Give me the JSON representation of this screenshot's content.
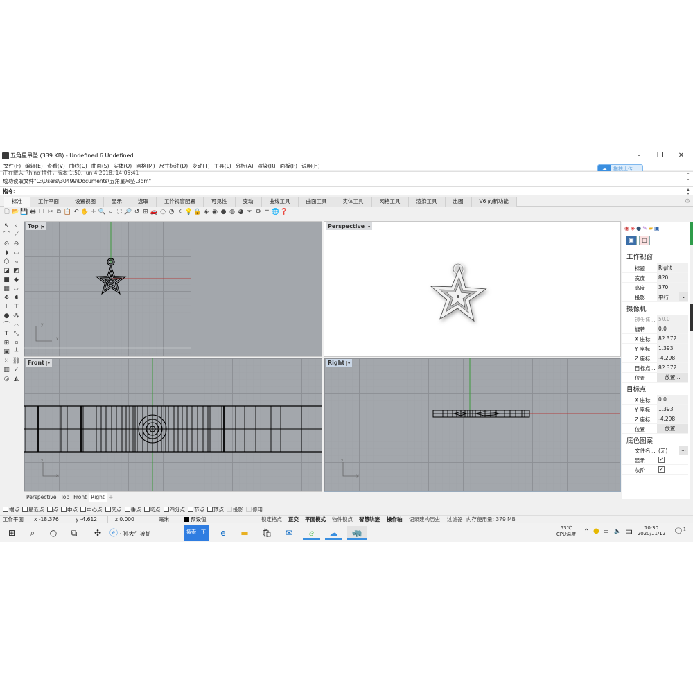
{
  "window": {
    "title": "五角星吊坠 (339 KB) - Undefined 6 Undefined",
    "minimize_icon": "minimize-icon",
    "restore_icon": "restore-icon",
    "close_icon": "close-icon"
  },
  "menu": [
    "文件(F)",
    "编辑(E)",
    "查看(V)",
    "曲线(C)",
    "曲面(S)",
    "实体(O)",
    "网格(M)",
    "尺寸标注(D)",
    "变动(T)",
    "工具(L)",
    "分析(A)",
    "渲染(R)",
    "面板(P)",
    "说明(H)"
  ],
  "upload_badge": {
    "label": "拖拽上传",
    "icon": "cloud-upload-icon"
  },
  "command": {
    "history_clipped": "正在载入 Rhino 插件，版本 1.50, Jun 4 2018, 14:05:41",
    "history_last": "成功读取文件\"C:\\Users\\30499\\Documents\\五角星吊坠.3dm\"",
    "prompt_label": "指令:",
    "input_value": ""
  },
  "toolbar_tabs": [
    "标准",
    "工作平面",
    "设置视图",
    "显示",
    "选取",
    "工作视窗配置",
    "可见性",
    "变动",
    "曲线工具",
    "曲面工具",
    "实体工具",
    "网格工具",
    "渲染工具",
    "出图",
    "V6 的新功能"
  ],
  "active_toolbar_tab": "标准",
  "toolbar_icons": [
    {
      "name": "new-icon",
      "glyph": "🗋"
    },
    {
      "name": "open-icon",
      "glyph": "📂"
    },
    {
      "name": "save-icon",
      "glyph": "💾"
    },
    {
      "name": "print-icon",
      "glyph": "🖶"
    },
    {
      "name": "import-icon",
      "glyph": "❐"
    },
    {
      "name": "cut-icon",
      "glyph": "✂"
    },
    {
      "name": "copy-icon",
      "glyph": "⧉"
    },
    {
      "name": "paste-icon",
      "glyph": "📋"
    },
    {
      "name": "undo-icon",
      "glyph": "↶"
    },
    {
      "name": "pan-icon",
      "glyph": "✋"
    },
    {
      "name": "rotate-view-icon",
      "glyph": "✛"
    },
    {
      "name": "zoom-icon",
      "glyph": "🔍"
    },
    {
      "name": "zoom-window-icon",
      "glyph": "⌕"
    },
    {
      "name": "zoom-extents-icon",
      "glyph": "⛶"
    },
    {
      "name": "zoom-selected-icon",
      "glyph": "🔎"
    },
    {
      "name": "undo-view-icon",
      "glyph": "↺"
    },
    {
      "name": "four-viewports-icon",
      "glyph": "⊞"
    },
    {
      "name": "car-icon",
      "glyph": "🚗"
    },
    {
      "name": "points-on-icon",
      "glyph": "◌"
    },
    {
      "name": "circle-icon",
      "glyph": "◔"
    },
    {
      "name": "select-icon",
      "glyph": "☇"
    },
    {
      "name": "light-icon",
      "glyph": "💡"
    },
    {
      "name": "lock-icon",
      "glyph": "🔒"
    },
    {
      "name": "layer-icon",
      "glyph": "◈"
    },
    {
      "name": "color-wheel-icon",
      "glyph": "◉"
    },
    {
      "name": "render-sphere-icon",
      "glyph": "●"
    },
    {
      "name": "material-sphere-icon",
      "glyph": "◍"
    },
    {
      "name": "environment-sphere-icon",
      "glyph": "◕"
    },
    {
      "name": "filter-icon",
      "glyph": "⏷"
    },
    {
      "name": "options-gear-icon",
      "glyph": "⚙"
    },
    {
      "name": "dimension-icon",
      "glyph": "⊏"
    },
    {
      "name": "globe-icon",
      "glyph": "🌐"
    },
    {
      "name": "help-icon",
      "glyph": "❓"
    }
  ],
  "left_toolbar": [
    {
      "name": "select-arrow-icon",
      "glyph": "↖"
    },
    {
      "name": "point-icon",
      "glyph": "∘"
    },
    {
      "name": "polyline-icon",
      "glyph": "⌒"
    },
    {
      "name": "control-point-curve-icon",
      "glyph": "⟋"
    },
    {
      "name": "circle-center-icon",
      "glyph": "⊙"
    },
    {
      "name": "ellipse-icon",
      "glyph": "⊖"
    },
    {
      "name": "arc-icon",
      "glyph": "◗"
    },
    {
      "name": "rectangle-icon",
      "glyph": "▭"
    },
    {
      "name": "polygon-icon",
      "glyph": "⬡"
    },
    {
      "name": "fillet-icon",
      "glyph": "⤷"
    },
    {
      "name": "surface-icon",
      "glyph": "◪"
    },
    {
      "name": "extrude-icon",
      "glyph": "◩"
    },
    {
      "name": "box-icon",
      "glyph": "■"
    },
    {
      "name": "boolean-icon",
      "glyph": "◆"
    },
    {
      "name": "mesh-icon",
      "glyph": "▦"
    },
    {
      "name": "plane-icon",
      "glyph": "▱"
    },
    {
      "name": "transform-icon",
      "glyph": "✥"
    },
    {
      "name": "explode-icon",
      "glyph": "✸"
    },
    {
      "name": "trim-icon",
      "glyph": "⊥"
    },
    {
      "name": "split-icon",
      "glyph": "⊤"
    },
    {
      "name": "group-icon",
      "glyph": "●"
    },
    {
      "name": "ungroup-icon",
      "glyph": "⁂"
    },
    {
      "name": "curve-offset-icon",
      "glyph": "⌒"
    },
    {
      "name": "blend-icon",
      "glyph": "⌓"
    },
    {
      "name": "text-icon",
      "glyph": "T"
    },
    {
      "name": "scale-icon",
      "glyph": "⤡"
    },
    {
      "name": "array-icon",
      "glyph": "⊞"
    },
    {
      "name": "mirror-icon",
      "glyph": "⧈"
    },
    {
      "name": "solid-tools-icon",
      "glyph": "▣"
    },
    {
      "name": "dimension-tools-icon",
      "glyph": "┴"
    },
    {
      "name": "grid-array-icon",
      "glyph": "⁙"
    },
    {
      "name": "chain-icon",
      "glyph": "⛓"
    },
    {
      "name": "analyze-icon",
      "glyph": "▥"
    },
    {
      "name": "check-icon",
      "glyph": "✓"
    },
    {
      "name": "render-icon",
      "glyph": "◎"
    },
    {
      "name": "paint-icon",
      "glyph": "◭"
    }
  ],
  "viewports": {
    "top": {
      "label": "Top",
      "axis_x": "x",
      "axis_y": "y"
    },
    "perspective": {
      "label": "Perspective"
    },
    "front": {
      "label": "Front",
      "axis_x": "x",
      "axis_y": "z"
    },
    "right": {
      "label": "Right",
      "axis_x": "y",
      "axis_y": "z"
    }
  },
  "viewport_tabs": [
    "Perspective",
    "Top",
    "Front",
    "Right"
  ],
  "active_viewport_tab": "Right",
  "add_viewport_tab_icon": "plus-icon",
  "osnaps": [
    {
      "label": "端点",
      "checked": false,
      "disabled": false
    },
    {
      "label": "最近点",
      "checked": false,
      "disabled": false
    },
    {
      "label": "点",
      "checked": false,
      "disabled": false
    },
    {
      "label": "中点",
      "checked": false,
      "disabled": false
    },
    {
      "label": "中心点",
      "checked": false,
      "disabled": false
    },
    {
      "label": "交点",
      "checked": false,
      "disabled": false
    },
    {
      "label": "垂点",
      "checked": false,
      "disabled": false
    },
    {
      "label": "切点",
      "checked": false,
      "disabled": false
    },
    {
      "label": "四分点",
      "checked": false,
      "disabled": false
    },
    {
      "label": "节点",
      "checked": false,
      "disabled": false
    },
    {
      "label": "顶点",
      "checked": false,
      "disabled": false
    },
    {
      "label": "投影",
      "checked": false,
      "disabled": true
    },
    {
      "label": "停用",
      "checked": false,
      "disabled": true
    }
  ],
  "status": {
    "cplane": "工作平面",
    "x": "x -18.376",
    "y": "y -4.612",
    "z": "z 0.000",
    "units": "毫米",
    "layer": "预设值",
    "layer_color": "#000000",
    "grid_snap": "锁定格点",
    "ortho": "正交",
    "planar": "平面模式",
    "osnap": "物件锁点",
    "smarttrack": "智慧轨迹",
    "gumball": "操作轴",
    "history": "记录建构历史",
    "filter": "过滤器",
    "memory": "内存使用量: 379 MB"
  },
  "taskbar": {
    "start_icon": "windows-start-icon",
    "search_icon": "search-icon",
    "cortana_icon": "cortana-circle-icon",
    "taskview_icon": "task-view-icon",
    "app_icon": "fan-app-icon",
    "ie_item_label": "孙大午被抓",
    "search_button": "搜索一下",
    "pinned": [
      "edge-icon",
      "file-explorer-icon",
      "store-icon",
      "mail-icon",
      "ie-browser-icon",
      "baidu-netdisk-icon",
      "rhino-icon"
    ],
    "cpu_temp": "53℃",
    "cpu_label": "CPU温度",
    "tray_chevron": "chevron-up-icon",
    "tray_icons": [
      "security-app-icon",
      "battery-icon",
      "volume-icon"
    ],
    "ime": "中",
    "time": "10:30",
    "date": "2020/11/12",
    "notification_count": "1"
  },
  "panel": {
    "tab_icons": [
      "color-wheel-icon",
      "layer-icon",
      "material-icon",
      "light-icon",
      "folder-icon",
      "help-book-icon"
    ],
    "viewport_section": "工作视窗",
    "viewport_rows": [
      {
        "key": "标题",
        "value": "Right"
      },
      {
        "key": "宽度",
        "value": "820"
      },
      {
        "key": "高度",
        "value": "370"
      },
      {
        "key": "投影",
        "value": "平行"
      }
    ],
    "camera_section": "摄像机",
    "camera_rows": [
      {
        "key": "镜头焦...",
        "value": "50.0",
        "disabled": true
      },
      {
        "key": "旋转",
        "value": "0.0"
      },
      {
        "key": "X 座标",
        "value": "82.372"
      },
      {
        "key": "Y 座标",
        "value": "1.393"
      },
      {
        "key": "Z 座标",
        "value": "-4.298"
      },
      {
        "key": "目标点...",
        "value": "82.372"
      }
    ],
    "camera_location_key": "位置",
    "place_button": "放置...",
    "target_section": "目标点",
    "target_rows": [
      {
        "key": "X 座标",
        "value": "0.0"
      },
      {
        "key": "Y 座标",
        "value": "1.393"
      },
      {
        "key": "Z 座标",
        "value": "-4.298"
      }
    ],
    "target_location_key": "位置",
    "wallpaper_section": "底色图案",
    "wallpaper_file_key": "文件名...",
    "wallpaper_file_value": "(无)",
    "browse_button": "...",
    "show_key": "显示",
    "show_checked": true,
    "gray_key": "灰阶",
    "gray_checked": true
  },
  "colors": {
    "axis_x": "#b04040",
    "axis_y": "#3c9a3c",
    "viewport_bg": "#a3a7ac",
    "accent": "#2f7de1"
  }
}
